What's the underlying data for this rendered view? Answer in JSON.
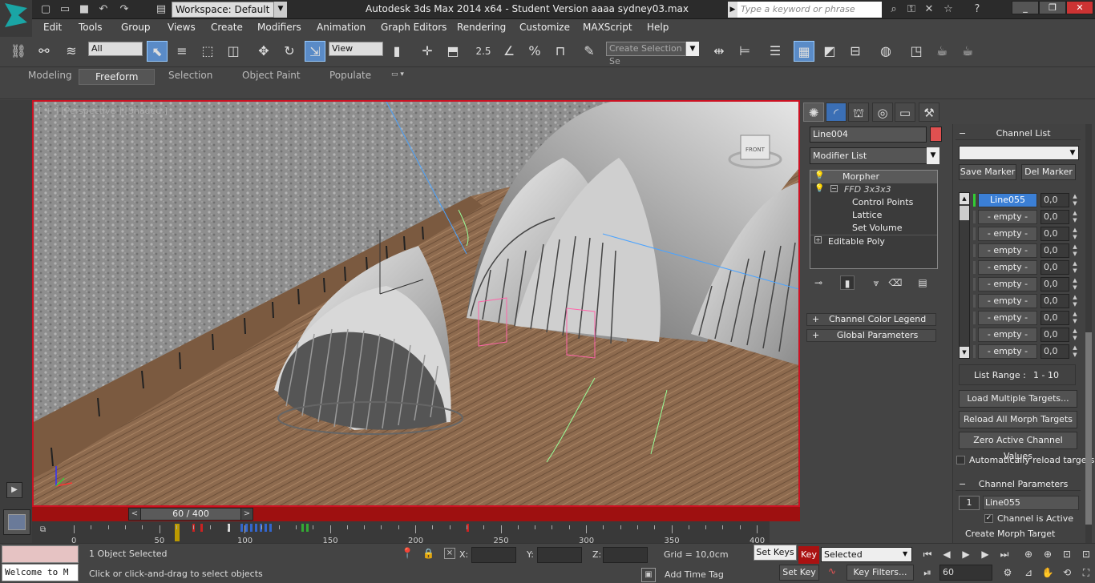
{
  "app": {
    "workspace": "Workspace: Default",
    "title": "Autodesk 3ds Max  2014 x64   - Student Version      aaaa sydney03.max",
    "search_placeholder": "Type a keyword or phrase"
  },
  "menu": [
    "Edit",
    "Tools",
    "Group",
    "Views",
    "Create",
    "Modifiers",
    "Animation",
    "Graph Editors",
    "Rendering",
    "Customize",
    "MAXScript",
    "Help"
  ],
  "toolbar": {
    "selection_filter": "All",
    "ref_coord": "View",
    "snap_angle": "2.5",
    "named_selection_placeholder": "Create Selection Se"
  },
  "ribbon_tabs": [
    "Modeling",
    "Freeform",
    "Selection",
    "Object Paint",
    "Populate"
  ],
  "viewport": {
    "label": "[ + ] [Perspective ] [Shaded ]",
    "view_cube_label": "FRONT"
  },
  "timeline": {
    "frame_display": "60 / 400",
    "ticks": [
      "0",
      "50",
      "100",
      "150",
      "200",
      "250",
      "300",
      "350",
      "400"
    ],
    "current_frame": 60,
    "total_frames": 400
  },
  "status": {
    "selection_text": "1 Object Selected",
    "prompt": "Click or click-and-drag to select objects",
    "maxscript_listener": "Welcome to M",
    "x_label": "X:",
    "y_label": "Y:",
    "z_label": "Z:",
    "grid": "Grid = 10,0cm",
    "add_time_tag": "Add Time Tag",
    "set_keys_tooltip": "Set Keys",
    "key_button": "Key",
    "key_mode": "Selected",
    "set_key": "Set Key",
    "key_filters": "Key Filters...",
    "frame_field": "60"
  },
  "command_panel": {
    "object_name": "Line004",
    "object_color": "#e05050",
    "modifier_list": "Modifier List",
    "stack": [
      {
        "label": "Morpher",
        "indent": 0,
        "italic": false
      },
      {
        "label": "FFD 3x3x3",
        "indent": 1,
        "italic": true
      },
      {
        "label": "Control Points",
        "indent": 2,
        "italic": false
      },
      {
        "label": "Lattice",
        "indent": 2,
        "italic": false
      },
      {
        "label": "Set Volume",
        "indent": 2,
        "italic": false
      },
      {
        "label": "Editable Poly",
        "indent": 0,
        "italic": false
      }
    ],
    "rollouts": [
      "Channel Color Legend",
      "Global Parameters"
    ]
  },
  "morpher": {
    "channel_list_title": "Channel List",
    "save_marker": "Save Marker",
    "del_marker": "Del Marker",
    "channels": [
      {
        "name": "Line055",
        "value": "0,0",
        "active": true
      },
      {
        "name": "- empty -",
        "value": "0,0",
        "active": false
      },
      {
        "name": "- empty -",
        "value": "0,0",
        "active": false
      },
      {
        "name": "- empty -",
        "value": "0,0",
        "active": false
      },
      {
        "name": "- empty -",
        "value": "0,0",
        "active": false
      },
      {
        "name": "- empty -",
        "value": "0,0",
        "active": false
      },
      {
        "name": "- empty -",
        "value": "0,0",
        "active": false
      },
      {
        "name": "- empty -",
        "value": "0,0",
        "active": false
      },
      {
        "name": "- empty -",
        "value": "0,0",
        "active": false
      },
      {
        "name": "- empty -",
        "value": "0,0",
        "active": false
      }
    ],
    "list_range_label": "List Range :",
    "list_range_value": "1 - 10",
    "load_multiple": "Load Multiple Targets...",
    "reload_all": "Reload All Morph Targets",
    "zero_active": "Zero Active Channel Values",
    "auto_reload": "Automatically reload targets",
    "channel_params_title": "Channel Parameters",
    "channel_number": "1",
    "channel_name": "Line055",
    "channel_active": "Channel is Active",
    "create_morph_target": "Create Morph Target"
  }
}
